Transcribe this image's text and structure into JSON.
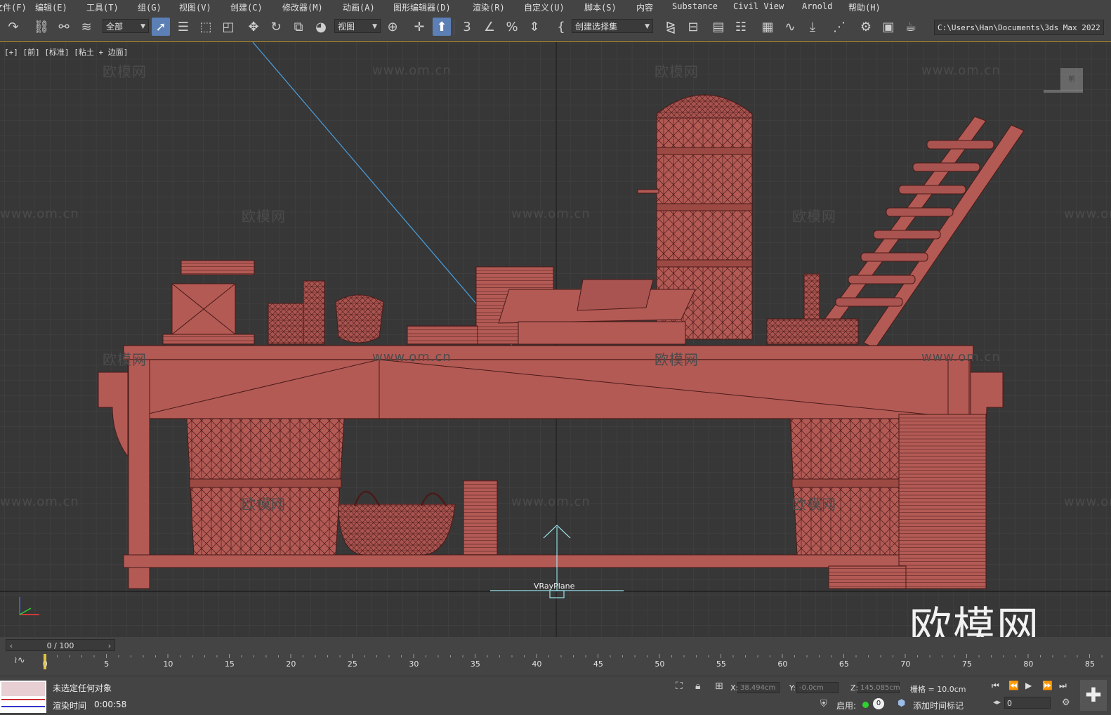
{
  "menu": [
    "文件(F)",
    "编辑(E)",
    "工具(T)",
    "组(G)",
    "视图(V)",
    "创建(C)",
    "修改器(M)",
    "动画(A)",
    "图形编辑器(D)",
    "渲染(R)",
    "自定义(U)",
    "脚本(S)",
    "内容",
    "Substance",
    "Civil View",
    "Arnold",
    "帮助(H)"
  ],
  "toolbar": {
    "filter_dropdown": "全部",
    "coord_dropdown": "视图",
    "selection_set": "创建选择集",
    "project_path": "C:\\Users\\Han\\Documents\\3ds Max 2022"
  },
  "viewport": {
    "label": "[+] [前] [标准] [粘土 + 边面]",
    "object_label": "VRayPlane",
    "watermark_cn": "欧模网",
    "watermark_url": "www.om.cn",
    "logo": "欧模网",
    "viewcube_text": "前"
  },
  "timeline": {
    "frame_display": "0 / 100",
    "ticks": [
      "0",
      "5",
      "10",
      "15",
      "20",
      "25",
      "30",
      "35",
      "40",
      "45",
      "50",
      "55",
      "60",
      "65",
      "70",
      "75",
      "80",
      "85"
    ]
  },
  "status": {
    "message": "未选定任何对象",
    "render_time_label": "渲染时间",
    "render_time": "0:00:58",
    "x_label": "X:",
    "x": "38.494cm",
    "y_label": "Y:",
    "y": "-0.0cm",
    "z_label": "Z:",
    "z": "145.085cm",
    "grid": "栅格 = 10.0cm",
    "enable_label": "启用:",
    "enable_count": "0",
    "add_time_tag": "添加时间标记",
    "current_frame": "0"
  },
  "colors": {
    "model": "#b35a55",
    "model_edge": "#4a1a18",
    "accent_blue": "#5c7fb5",
    "grid_line": "#454545"
  }
}
